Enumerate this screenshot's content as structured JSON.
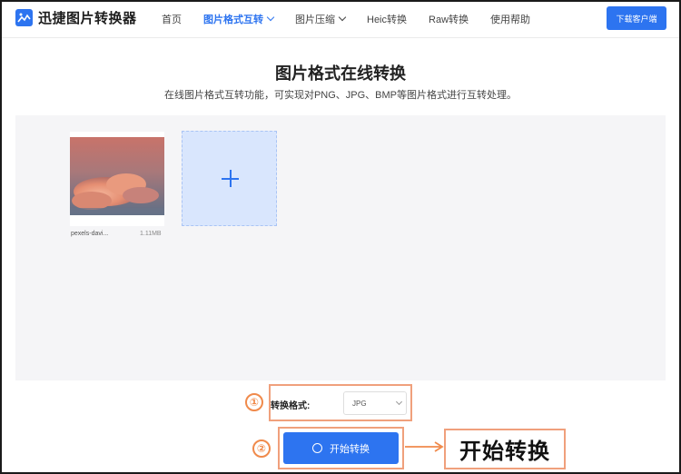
{
  "header": {
    "logo_text": "迅捷图片转换器",
    "nav": [
      {
        "label": "首页",
        "active": false,
        "dropdown": false
      },
      {
        "label": "图片格式互转",
        "active": true,
        "dropdown": true
      },
      {
        "label": "图片压缩",
        "active": false,
        "dropdown": true
      },
      {
        "label": "Heic转换",
        "active": false,
        "dropdown": false
      },
      {
        "label": "Raw转换",
        "active": false,
        "dropdown": false
      },
      {
        "label": "使用帮助",
        "active": false,
        "dropdown": false
      }
    ],
    "download_label": "下载客户端"
  },
  "main": {
    "title": "图片格式在线转换",
    "subtitle": "在线图片格式互转功能，可实现对PNG、JPG、BMP等图片格式进行互转处理。"
  },
  "upload": {
    "file": {
      "name": "pexels-davi...",
      "size": "1.11MB"
    }
  },
  "format": {
    "label": "转换格式:",
    "selected": "JPG"
  },
  "steps": {
    "one": "①",
    "two": "②"
  },
  "start_button": {
    "label": "开始转换"
  },
  "callout": {
    "text": "开始转换"
  },
  "colors": {
    "accent": "#2d74f0",
    "annotation": "#f08a4b",
    "upload_bg": "#f5f5f7"
  }
}
